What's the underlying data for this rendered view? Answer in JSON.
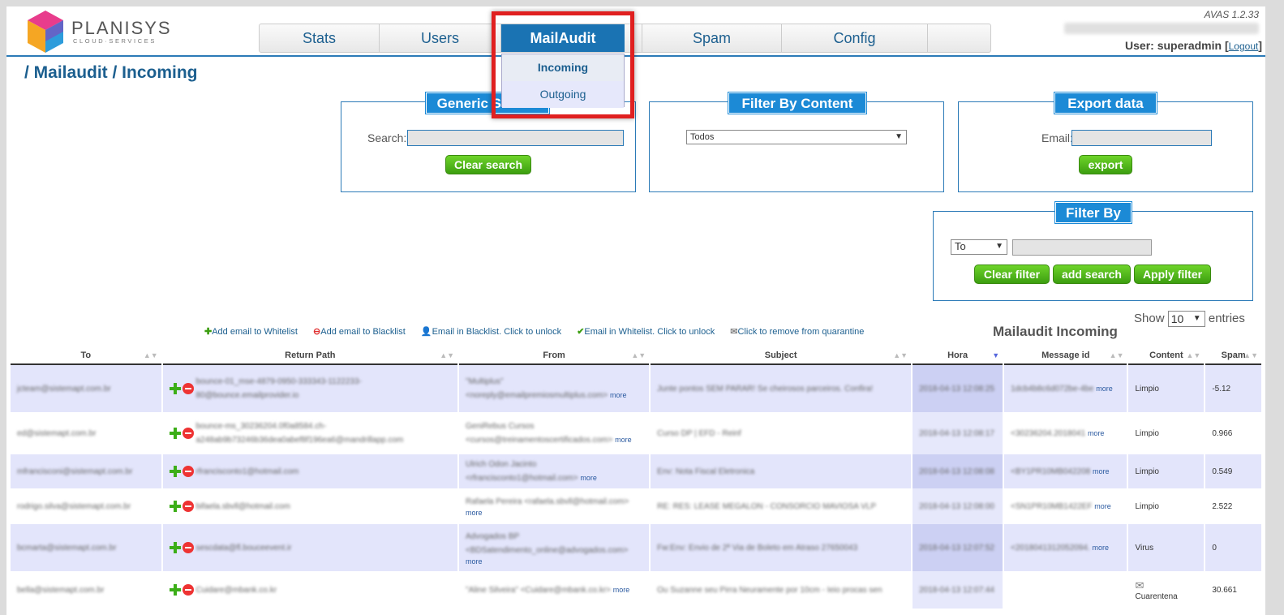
{
  "header": {
    "logo_name": "PLANISYS",
    "logo_sub": "CLOUD·SERVICES",
    "version": "AVAS 1.2.33",
    "user_label": "User: superadmin [",
    "logout": "Logout",
    "user_close": "]"
  },
  "nav": {
    "tabs": [
      "Stats",
      "Users",
      "MailAudit",
      "Spam",
      "Config",
      ""
    ],
    "active": "MailAudit"
  },
  "dropdown": {
    "items": [
      "Incoming",
      "Outgoing"
    ]
  },
  "breadcrumb": "/ Mailaudit / Incoming",
  "generic_search": {
    "title": "Generic Search",
    "label": "Search:",
    "button": "Clear search"
  },
  "filter_content": {
    "title": "Filter By Content",
    "selected": "Todos"
  },
  "export": {
    "title": "Export data",
    "label": "Email:",
    "button": "export"
  },
  "filter_by": {
    "title": "Filter By",
    "selected": "To",
    "buttons": [
      "Clear filter",
      "add search",
      "Apply filter"
    ]
  },
  "show_entries": {
    "prefix": "Show",
    "value": "10",
    "suffix": "entries"
  },
  "legend": [
    "Add email to Whitelist",
    "Add email to Blacklist",
    "Email in Blacklist. Click to unlock",
    "Email in Whitelist. Click to unlock",
    "Click to remove from quarantine"
  ],
  "table_title": "Mailaudit Incoming",
  "columns": [
    "To",
    "Return Path",
    "From",
    "Subject",
    "Hora",
    "Message id",
    "Content",
    "Spam"
  ],
  "rows": [
    {
      "to": "jcteam@sistemapt.com.br",
      "return_path": "bounce-01_mse-4879-0950-333343-1122233-80@bounce.emailprovider.io",
      "from": "\"Multiplus\" <noreply@emailpremiosmultiplus.com>",
      "subject": "Junte pontos SEM PARAR! Se cheirosos parceiros. Confira!",
      "hora": "2018-04-13 12:08:25",
      "message_id": "1dcb4b8c6d072be-4be",
      "content": "Limpio",
      "spam": "-5.12"
    },
    {
      "to": "ed@sistemapt.com.br",
      "return_path": "bounce-ms_30236204.0f0a8584.ch-a248ab9b73246b36dea0abef8f196ea6@mandrillapp.com",
      "from": "GeniRebus Cursos <cursos@treinamentoscertificados.com>",
      "subject": "Curso DP | EFD - Reinf",
      "hora": "2018-04-13 12:08:17",
      "message_id": "<30236204.2018041",
      "content": "Limpio",
      "spam": "0.966"
    },
    {
      "to": "mfrancisconi@sistemapt.com.br",
      "return_path": "rfrancisconto1@hotmail.com",
      "from": "Ulrich Odon Jacinto <rfrancisconto1@hotmail.com>",
      "subject": "Env: Nota Fiscal Eletronica",
      "hora": "2018-04-13 12:08:08",
      "message_id": "<BY1PR10MB042208",
      "content": "Limpio",
      "spam": "0.549"
    },
    {
      "to": "rodrigo.silva@sistemapt.com.br",
      "return_path": "bifaela.sbvll@hotmail.com",
      "from": "Rafaela Pereira <rafaela.sbvll@hotmail.com>",
      "subject": "RE: RES: LEASE MEGALON - CONSORCIO MAVIOSA VLP",
      "hora": "2018-04-13 12:08:00",
      "message_id": "<SN1PR10MB1422EF",
      "content": "Limpio",
      "spam": "2.522"
    },
    {
      "to": "bcmarta@sistemapt.com.br",
      "return_path": "sescdata@fl.bouceevent.ir",
      "from": "Advogados BP <BDSatendimento_online@advogados.com>",
      "subject": "Fw:Env: Envio de 2ª Via de Boleto em Atraso 27650043",
      "hora": "2018-04-13 12:07:52",
      "message_id": "<2018041312052094.",
      "content": "Virus",
      "spam": "0"
    },
    {
      "to": "bella@sistemapt.com.br",
      "return_path": "Cuidare@mbank.co.kr",
      "from": "\"Aline Silveira\" <Cuidare@mbank.co.kr>",
      "subject": "Ou Suzanne seu Pirra Neuramente por 10cm - Ieio procas sen",
      "hora": "2018-04-13 12:07:44",
      "message_id": "",
      "content": "Cuarentena",
      "spam": "30.661"
    }
  ],
  "more_label": "more",
  "colors": {
    "accent": "#1c8ad6",
    "nav_active": "#1a73b3",
    "button_green": "#4cb41a",
    "highlight": "#e02020"
  }
}
